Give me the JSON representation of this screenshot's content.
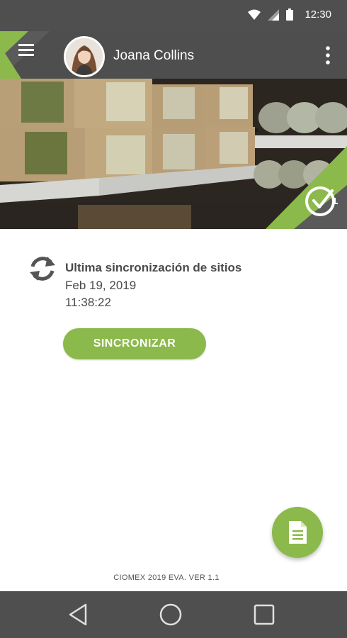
{
  "status_bar": {
    "time": "12:30",
    "icons": [
      "wifi-icon",
      "signal-icon",
      "battery-icon"
    ]
  },
  "header": {
    "user_name": "Joana Collins",
    "menu_icon": "hamburger-menu-icon",
    "overflow_icon": "more-vert-icon",
    "brand_logo_icon": "check-clock-logo-icon"
  },
  "sync": {
    "title": "Ultima sincronización de sitios",
    "date": "Feb 19, 2019",
    "time": "11:38:22",
    "button_label": "SINCRONIZAR",
    "icon": "sync-icon"
  },
  "fab": {
    "icon": "document-icon"
  },
  "footer": {
    "version": "CIOMEX 2019 EVA. VER 1.1"
  },
  "nav_bar": {
    "icons": [
      "back-icon",
      "home-icon",
      "recents-icon"
    ]
  },
  "colors": {
    "accent": "#8bb94b",
    "app_bar": "#4e4e4e",
    "status_bar": "#4f4f4f",
    "text": "#4a4a4a"
  }
}
